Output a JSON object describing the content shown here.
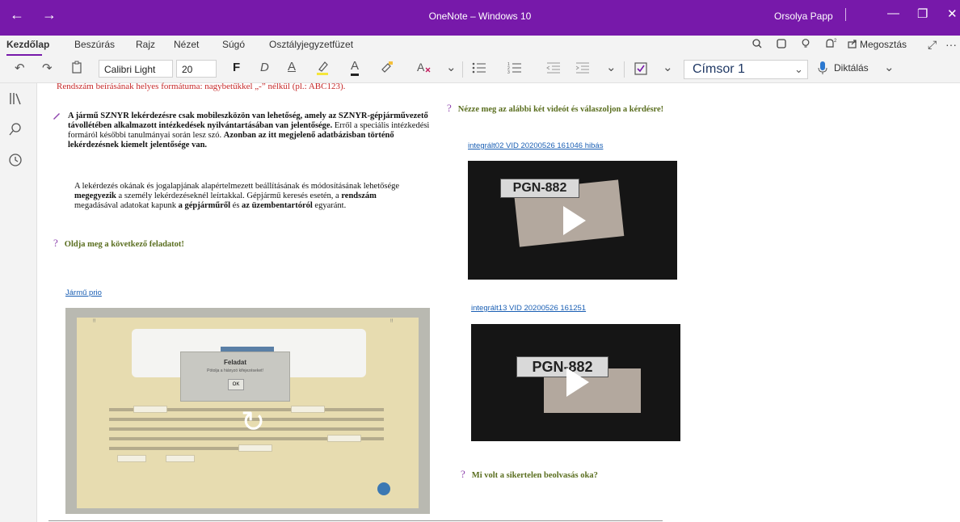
{
  "titlebar": {
    "back": "←",
    "forward": "→",
    "title": "OneNote – Windows 10",
    "user": "Orsolya Papp",
    "minimize": "—",
    "restore": "❐",
    "close": "✕"
  },
  "menu": {
    "tabs": [
      "Kezdőlap",
      "Beszúrás",
      "Rajz",
      "Nézet",
      "Súgó",
      "Osztályjegyzetfüzet"
    ],
    "share_label": "Megosztás",
    "expand": "⤢",
    "more": "···",
    "icons": [
      "tell-me-icon",
      "notebook-icon",
      "lightbulb-icon",
      "bell-icon"
    ]
  },
  "toolbar": {
    "undo": "↶",
    "redo": "↷",
    "clipboard": "📋",
    "font_name": "Calibri Light",
    "font_size": "20",
    "bold": "F",
    "italic": "D",
    "underline": "A",
    "highlight": "A",
    "font_color": "A",
    "style_name": "Címsor 1",
    "dictate_label": "Diktálás",
    "chevron": "⌄",
    "accent_color": "#7719aa"
  },
  "page": {
    "cut_line": "Rendszám beírásának helyes formátuma: nagybetűkkel „-” nélkül (pl.: ABC123).",
    "para1": {
      "b1": "A jármű SZNYR lekérdezésre csak mobileszközön van lehetőség, amely az SZNYR-gépjárművezető távollétében alkalmazott intézkedések nyilvántartásában van jelentősége.",
      "t1": " Erről a speciális intézkedési formáról későbbi tanulmányai során lesz szó. ",
      "b2": "Azonban az itt megjelenő adatbázisban történő lekérdezésnek kiemelt jelentősége van."
    },
    "para2": {
      "t1": "A lekérdezés okának és jogalapjának alapértelmezett beállításának és módosításának lehetősége ",
      "b1": "megegyezik",
      "t2": " a személy lekérdezéseknél leírtakkal. Gépjármű keresés esetén, a ",
      "b2": "rendszám",
      "t3": " megadásával adatokat kapunk ",
      "b3": "a gépjárműről",
      "t4": " és ",
      "b4": "az üzembentartóról",
      "t5": " egyaránt."
    },
    "question1": "Oldja meg a következő feladatot!",
    "link1": "Jármű prio",
    "question_videos": "Nézze meg az alábbi két videót és válaszoljon a kérdésre!",
    "video1_link": "integrált02 VID 20200526 161046 hibás",
    "video2_link": "integrált13 VID 20200526 161251",
    "video1_plate": "PGN-882",
    "video2_plate": "PGN-882",
    "question2": "Mi volt a sikertelen beolvasás oka?",
    "qmark": "?"
  },
  "embed": {
    "dialog_title": "Feladat",
    "dialog_sub": "Pótolja a hiányzó kifejezéseket!",
    "ok_label": "OK",
    "reload": "↻",
    "corner_left": "!!",
    "corner_right": "!!"
  },
  "sidebar": {
    "icons": [
      "notebooks-icon",
      "search-icon",
      "recent-icon"
    ],
    "glyphs": [
      "⫼",
      "⚲",
      "◷"
    ]
  }
}
